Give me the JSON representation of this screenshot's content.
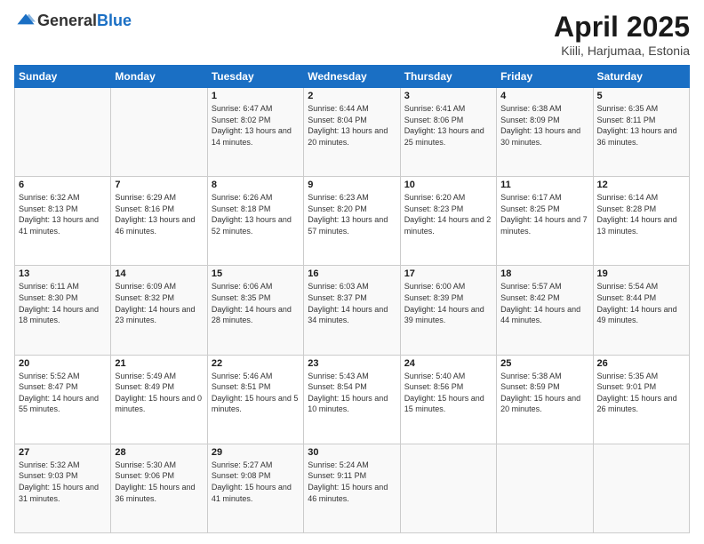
{
  "header": {
    "logo_general": "General",
    "logo_blue": "Blue",
    "title": "April 2025",
    "subtitle": "Kiili, Harjumaa, Estonia"
  },
  "days_of_week": [
    "Sunday",
    "Monday",
    "Tuesday",
    "Wednesday",
    "Thursday",
    "Friday",
    "Saturday"
  ],
  "weeks": [
    [
      {
        "day": "",
        "info": ""
      },
      {
        "day": "",
        "info": ""
      },
      {
        "day": "1",
        "info": "Sunrise: 6:47 AM\nSunset: 8:02 PM\nDaylight: 13 hours and 14 minutes."
      },
      {
        "day": "2",
        "info": "Sunrise: 6:44 AM\nSunset: 8:04 PM\nDaylight: 13 hours and 20 minutes."
      },
      {
        "day": "3",
        "info": "Sunrise: 6:41 AM\nSunset: 8:06 PM\nDaylight: 13 hours and 25 minutes."
      },
      {
        "day": "4",
        "info": "Sunrise: 6:38 AM\nSunset: 8:09 PM\nDaylight: 13 hours and 30 minutes."
      },
      {
        "day": "5",
        "info": "Sunrise: 6:35 AM\nSunset: 8:11 PM\nDaylight: 13 hours and 36 minutes."
      }
    ],
    [
      {
        "day": "6",
        "info": "Sunrise: 6:32 AM\nSunset: 8:13 PM\nDaylight: 13 hours and 41 minutes."
      },
      {
        "day": "7",
        "info": "Sunrise: 6:29 AM\nSunset: 8:16 PM\nDaylight: 13 hours and 46 minutes."
      },
      {
        "day": "8",
        "info": "Sunrise: 6:26 AM\nSunset: 8:18 PM\nDaylight: 13 hours and 52 minutes."
      },
      {
        "day": "9",
        "info": "Sunrise: 6:23 AM\nSunset: 8:20 PM\nDaylight: 13 hours and 57 minutes."
      },
      {
        "day": "10",
        "info": "Sunrise: 6:20 AM\nSunset: 8:23 PM\nDaylight: 14 hours and 2 minutes."
      },
      {
        "day": "11",
        "info": "Sunrise: 6:17 AM\nSunset: 8:25 PM\nDaylight: 14 hours and 7 minutes."
      },
      {
        "day": "12",
        "info": "Sunrise: 6:14 AM\nSunset: 8:28 PM\nDaylight: 14 hours and 13 minutes."
      }
    ],
    [
      {
        "day": "13",
        "info": "Sunrise: 6:11 AM\nSunset: 8:30 PM\nDaylight: 14 hours and 18 minutes."
      },
      {
        "day": "14",
        "info": "Sunrise: 6:09 AM\nSunset: 8:32 PM\nDaylight: 14 hours and 23 minutes."
      },
      {
        "day": "15",
        "info": "Sunrise: 6:06 AM\nSunset: 8:35 PM\nDaylight: 14 hours and 28 minutes."
      },
      {
        "day": "16",
        "info": "Sunrise: 6:03 AM\nSunset: 8:37 PM\nDaylight: 14 hours and 34 minutes."
      },
      {
        "day": "17",
        "info": "Sunrise: 6:00 AM\nSunset: 8:39 PM\nDaylight: 14 hours and 39 minutes."
      },
      {
        "day": "18",
        "info": "Sunrise: 5:57 AM\nSunset: 8:42 PM\nDaylight: 14 hours and 44 minutes."
      },
      {
        "day": "19",
        "info": "Sunrise: 5:54 AM\nSunset: 8:44 PM\nDaylight: 14 hours and 49 minutes."
      }
    ],
    [
      {
        "day": "20",
        "info": "Sunrise: 5:52 AM\nSunset: 8:47 PM\nDaylight: 14 hours and 55 minutes."
      },
      {
        "day": "21",
        "info": "Sunrise: 5:49 AM\nSunset: 8:49 PM\nDaylight: 15 hours and 0 minutes."
      },
      {
        "day": "22",
        "info": "Sunrise: 5:46 AM\nSunset: 8:51 PM\nDaylight: 15 hours and 5 minutes."
      },
      {
        "day": "23",
        "info": "Sunrise: 5:43 AM\nSunset: 8:54 PM\nDaylight: 15 hours and 10 minutes."
      },
      {
        "day": "24",
        "info": "Sunrise: 5:40 AM\nSunset: 8:56 PM\nDaylight: 15 hours and 15 minutes."
      },
      {
        "day": "25",
        "info": "Sunrise: 5:38 AM\nSunset: 8:59 PM\nDaylight: 15 hours and 20 minutes."
      },
      {
        "day": "26",
        "info": "Sunrise: 5:35 AM\nSunset: 9:01 PM\nDaylight: 15 hours and 26 minutes."
      }
    ],
    [
      {
        "day": "27",
        "info": "Sunrise: 5:32 AM\nSunset: 9:03 PM\nDaylight: 15 hours and 31 minutes."
      },
      {
        "day": "28",
        "info": "Sunrise: 5:30 AM\nSunset: 9:06 PM\nDaylight: 15 hours and 36 minutes."
      },
      {
        "day": "29",
        "info": "Sunrise: 5:27 AM\nSunset: 9:08 PM\nDaylight: 15 hours and 41 minutes."
      },
      {
        "day": "30",
        "info": "Sunrise: 5:24 AM\nSunset: 9:11 PM\nDaylight: 15 hours and 46 minutes."
      },
      {
        "day": "",
        "info": ""
      },
      {
        "day": "",
        "info": ""
      },
      {
        "day": "",
        "info": ""
      }
    ]
  ]
}
